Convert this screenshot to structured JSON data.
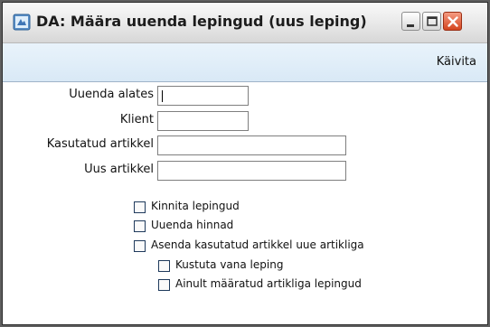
{
  "window": {
    "title": "DA: Määra uuenda lepingud (uus leping)",
    "icon": "document-app-icon"
  },
  "toolbar": {
    "run_label": "Käivita"
  },
  "form": {
    "fields": [
      {
        "label": "Uuenda alates",
        "value": ""
      },
      {
        "label": "Klient",
        "value": ""
      },
      {
        "label": "Kasutatud artikkel",
        "value": ""
      },
      {
        "label": "Uus artikkel",
        "value": ""
      }
    ],
    "checkboxes": [
      {
        "label": "Kinnita lepingud",
        "checked": false
      },
      {
        "label": "Uuenda hinnad",
        "checked": false
      },
      {
        "label": "Asenda kasutatud artikkel uue artikliga",
        "checked": false
      },
      {
        "label": "Kustuta vana leping",
        "checked": false
      },
      {
        "label": "Ainult määratud artikliga lepingud",
        "checked": false
      }
    ]
  },
  "colors": {
    "toolbar_bg": "#d9e9f6",
    "close_button": "#d4451e",
    "window_bg": "#ece9d8"
  }
}
